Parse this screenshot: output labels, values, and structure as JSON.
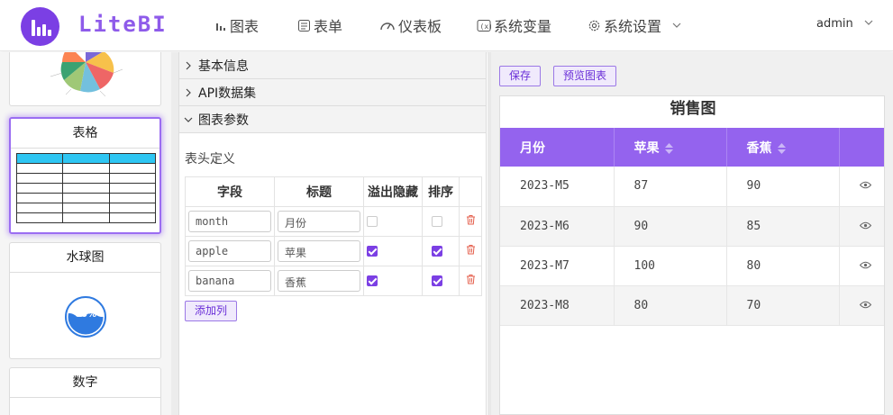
{
  "app": {
    "name": "LiteBI",
    "user": "admin"
  },
  "nav": [
    {
      "label": "图表",
      "icon": "bar-chart-icon"
    },
    {
      "label": "表单",
      "icon": "form-icon"
    },
    {
      "label": "仪表板",
      "icon": "gauge-icon"
    },
    {
      "label": "系统变量",
      "icon": "variable-icon"
    },
    {
      "label": "系统设置",
      "icon": "gear-icon"
    }
  ],
  "components": [
    {
      "title": "表格"
    },
    {
      "title": "水球图",
      "value": "60%"
    },
    {
      "title": "数字"
    }
  ],
  "accordion": [
    {
      "label": "基本信息",
      "expanded": false
    },
    {
      "label": "API数据集",
      "expanded": false
    },
    {
      "label": "图表参数",
      "expanded": true
    }
  ],
  "params": {
    "section_label": "表头定义",
    "headers": [
      "字段",
      "标题",
      "溢出隐藏",
      "排序"
    ],
    "rows": [
      {
        "field": "month",
        "title": "月份",
        "overflow_hidden": false,
        "sortable": false
      },
      {
        "field": "apple",
        "title": "苹果",
        "overflow_hidden": true,
        "sortable": true
      },
      {
        "field": "banana",
        "title": "香蕉",
        "overflow_hidden": true,
        "sortable": true
      }
    ],
    "add_label": "添加列"
  },
  "toolbar": {
    "save_label": "保存",
    "preview_label": "预览图表"
  },
  "preview": {
    "title": "销售图",
    "headers": [
      "月份",
      "苹果",
      "香蕉"
    ],
    "rows": [
      [
        "2023-M5",
        "87",
        "90"
      ],
      [
        "2023-M6",
        "90",
        "85"
      ],
      [
        "2023-M7",
        "100",
        "80"
      ],
      [
        "2023-M8",
        "80",
        "70"
      ]
    ]
  },
  "colors": {
    "accent": "#7b3fe4",
    "header_bg": "#9463ee",
    "brand": "#8e5bea"
  }
}
